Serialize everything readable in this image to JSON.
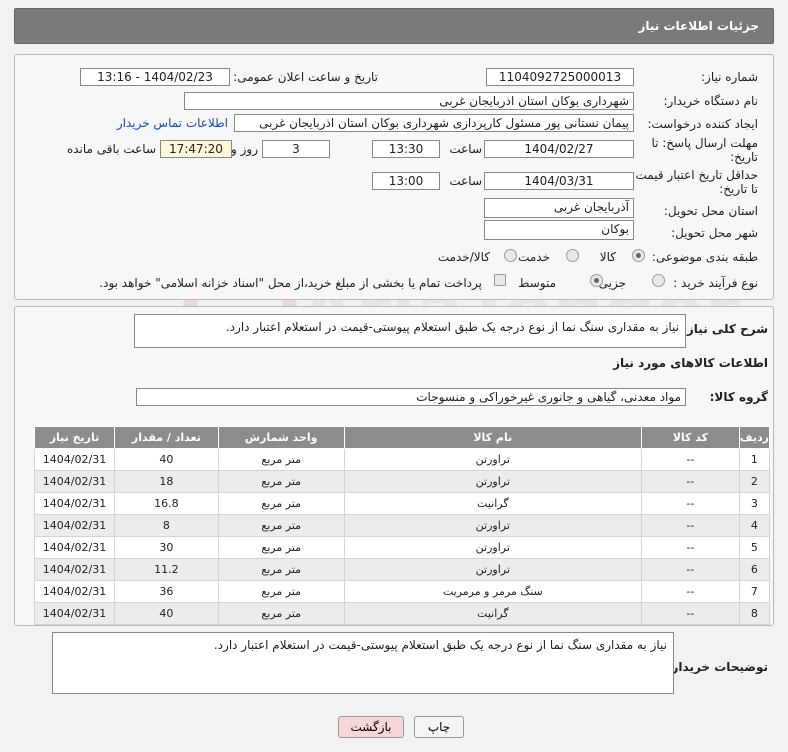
{
  "header": {
    "title": "جزئیات اطلاعات نیاز"
  },
  "form": {
    "need_number_label": "شماره نیاز:",
    "need_number": "1104092725000013",
    "announce_label": "تاریخ و ساعت اعلان عمومی:",
    "announce_value": "1404/02/23 - 13:16",
    "buyer_org_label": "نام دستگاه خریدار:",
    "buyer_org": "شهرداری بوکان استان اذربایجان غربی",
    "requester_label": "ایجاد کننده درخواست:",
    "requester": "پیمان نستانی پور مسئول کارپردازی شهرداری بوکان استان اذربایجان غربی",
    "contact_link": "اطلاعات تماس خریدار",
    "deadline_label_1": "مهلت ارسال پاسخ: تا",
    "deadline_label_2": "تاریخ:",
    "deadline_date": "1404/02/27",
    "time_label": "ساعت",
    "deadline_time": "13:30",
    "days_value": "3",
    "days_label": "روز و",
    "remaining_value": "17:47:20",
    "remaining_label": "ساعت باقی مانده",
    "validity_label_1": "حداقل تاریخ اعتبار قیمت:",
    "validity_label_2": "تا تاریخ:",
    "validity_date": "1404/03/31",
    "validity_time": "13:00",
    "province_label": "استان محل تحویل:",
    "province": "آذربایجان غربی",
    "city_label": "شهر محل تحویل:",
    "city": "بوکان",
    "category_label": "طبقه بندی موضوعی:",
    "category_options": [
      "کالا",
      "خدمت",
      "کالا/خدمت"
    ],
    "process_label": "نوع فرآیند خرید :",
    "process_options": [
      "جزیی",
      "متوسط"
    ],
    "payment_note": "پرداخت تمام یا بخشی از مبلغ خرید،از محل \"اسناد خزانه اسلامی\" خواهد بود."
  },
  "desc": {
    "label": "شرح کلی نیاز:",
    "text": "نیاز به مقداری سنگ نما از نوع درجه یک طبق استعلام پیوستی-قیمت در استعلام اعتبار دارد."
  },
  "goods": {
    "section_title": "اطلاعات کالاهای مورد نیاز",
    "group_label": "گروه کالا:",
    "group_value": "مواد معدنی، گیاهی و جانوری غیرخوراکی و منسوجات",
    "columns": [
      "ردیف",
      "کد کالا",
      "نام کالا",
      "واحد شمارش",
      "تعداد / مقدار",
      "تاریخ نیاز"
    ],
    "rows": [
      [
        "1",
        "--",
        "تراورتن",
        "متر مربع",
        "40",
        "1404/02/31"
      ],
      [
        "2",
        "--",
        "تراورتن",
        "متر مربع",
        "18",
        "1404/02/31"
      ],
      [
        "3",
        "--",
        "گرانیت",
        "متر مربع",
        "16.8",
        "1404/02/31"
      ],
      [
        "4",
        "--",
        "تراورتن",
        "متر مربع",
        "8",
        "1404/02/31"
      ],
      [
        "5",
        "--",
        "تراورتن",
        "متر مربع",
        "30",
        "1404/02/31"
      ],
      [
        "6",
        "--",
        "تراورتن",
        "متر مربع",
        "11.2",
        "1404/02/31"
      ],
      [
        "7",
        "--",
        "سنگ مرمر و مرمریت",
        "متر مربع",
        "36",
        "1404/02/31"
      ],
      [
        "8",
        "--",
        "گرانیت",
        "متر مربع",
        "40",
        "1404/02/31"
      ]
    ]
  },
  "buyer_notes": {
    "label": "توضیحات خریدار:",
    "text": "نیاز به مقداری سنگ نما از نوع درجه یک طبق استعلام پیوستی-قیمت در استعلام اعتبار دارد."
  },
  "buttons": {
    "print": "چاپ",
    "back": "بازگشت"
  },
  "watermark": {
    "text": "AriaTender.neT"
  },
  "colors": {
    "header": "#7a7a7a",
    "table_header": "#8c8c8c",
    "back_button": "#f6d6d6",
    "link": "#1a4aa8"
  }
}
